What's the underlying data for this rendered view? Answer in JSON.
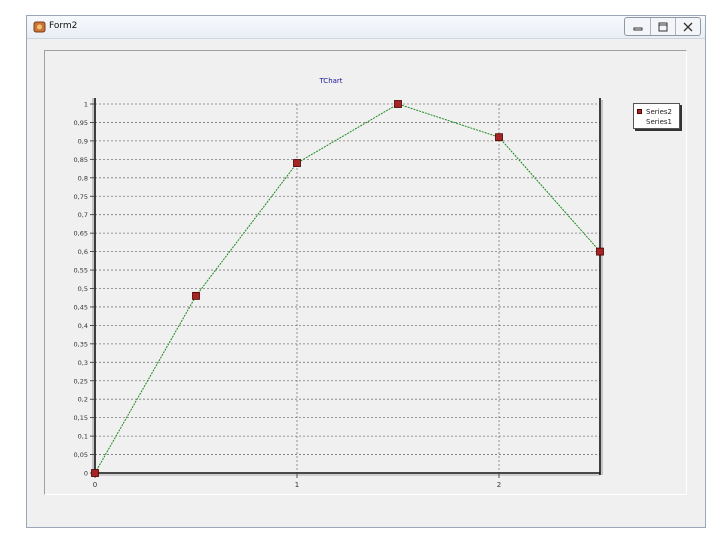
{
  "window": {
    "title": "Form2"
  },
  "chart_data": {
    "type": "line",
    "title": "TChart",
    "x": [
      0,
      0.5,
      1,
      1.5,
      2,
      2.5
    ],
    "series": [
      {
        "name": "Series2",
        "values": [
          0,
          0.48,
          0.84,
          1.0,
          0.91,
          0.6
        ]
      }
    ],
    "xlim": [
      0,
      2.5
    ],
    "ylim": [
      0,
      1
    ],
    "xticks": [
      "0",
      "1",
      "2"
    ],
    "yticks": [
      "0",
      "0,05",
      "0,1",
      "0,15",
      "0,2",
      "0,25",
      "0,3",
      "0,35",
      "0,4",
      "0,45",
      "0,5",
      "0,55",
      "0,6",
      "0,65",
      "0,7",
      "0,75",
      "0,8",
      "0,85",
      "0,9",
      "0,95",
      "1"
    ],
    "grid": true,
    "legend_position": "top-right",
    "line_color": "#1e8a1e",
    "marker_color": "#a52424"
  },
  "legend": {
    "items": [
      {
        "label": "Series2"
      },
      {
        "label": "Series1"
      }
    ]
  }
}
